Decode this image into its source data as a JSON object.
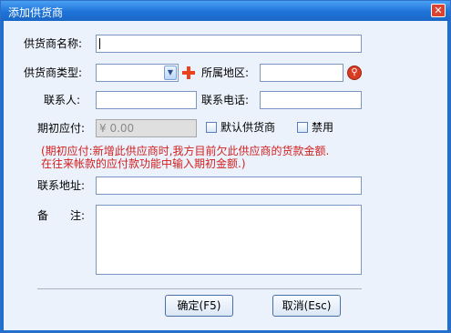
{
  "window": {
    "title": "添加供货商",
    "close_glyph": "✕"
  },
  "form": {
    "name_label": "供货商名称:",
    "name_value": "",
    "type_label": "供货商类型:",
    "type_value": "",
    "region_label": "所属地区:",
    "region_value": "",
    "contact_label": "联系人:",
    "contact_value": "",
    "phone_label": "联系电话:",
    "phone_value": "",
    "opening_label": "期初应付:",
    "opening_value": "¥ 0.00",
    "default_label": "默认供货商",
    "default_checked": false,
    "disabled_label": "禁用",
    "disabled_checked": false,
    "note_line1": "(期初应付:新增此供应商时,我方目前欠此供应商的货款金额.",
    "note_line2": "在往来帐款的应付款功能中输入期初金额.)",
    "address_label": "联系地址:",
    "address_value": "",
    "remark_label": "备　　注:",
    "remark_value": ""
  },
  "buttons": {
    "ok": "确定(F5)",
    "cancel": "取消(Esc)"
  },
  "icons": {
    "dropdown": "chevron-down-icon",
    "add": "plus-icon",
    "region_picker": "search-icon"
  },
  "colors": {
    "titlebar": "#1e73d8",
    "note_text": "#d12020",
    "plus": "#e8431c"
  }
}
